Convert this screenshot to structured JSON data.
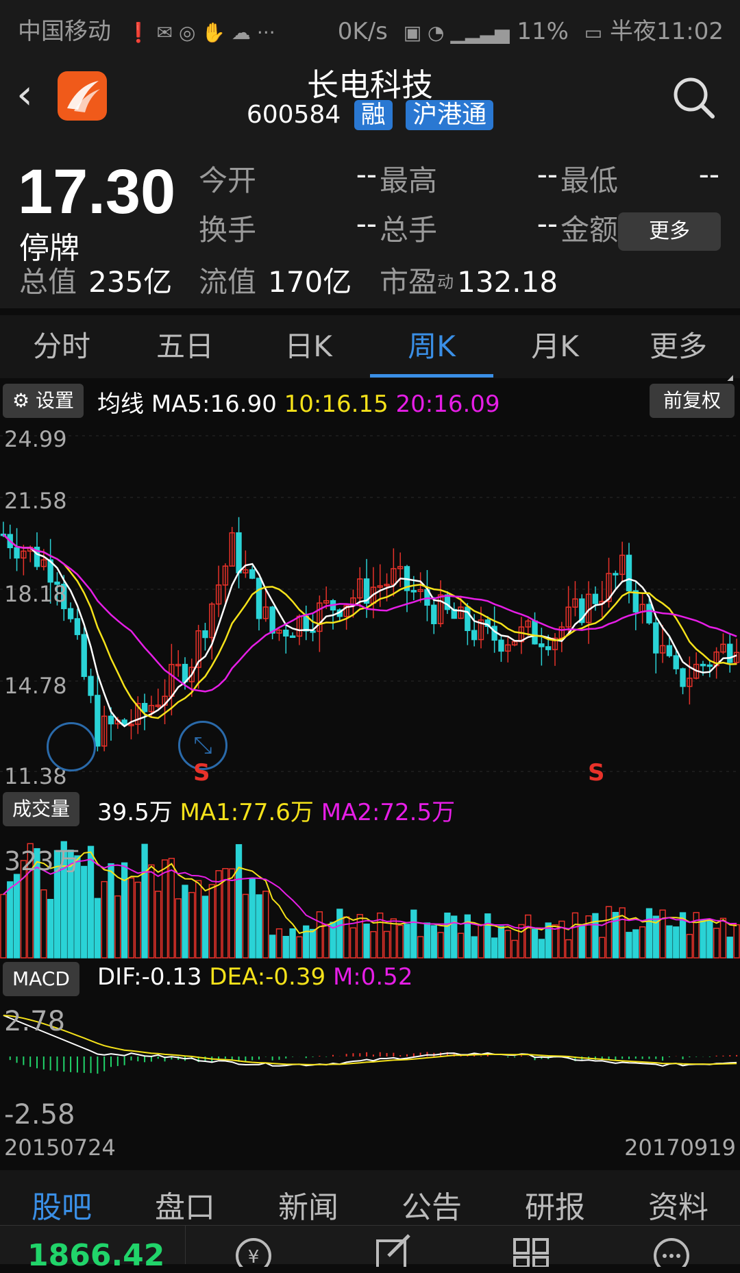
{
  "status_bar": {
    "carrier": "中国移动",
    "speed": "0K/s",
    "battery": "11%",
    "time": "半夜11:02"
  },
  "header": {
    "title": "长电科技",
    "code": "600584",
    "tag1": "融",
    "tag2": "沪港通"
  },
  "quote": {
    "price": "17.30",
    "status": "停牌",
    "open_label": "今开",
    "open": "--",
    "high_label": "最高",
    "high": "--",
    "low_label": "最低",
    "low": "--",
    "turnover_label": "换手",
    "turnover": "--",
    "volume_label": "总手",
    "volume": "--",
    "amount_label": "金额",
    "amount": "--",
    "mktcap_label": "总值",
    "mktcap": "235亿",
    "float_label": "流值",
    "float": "170亿",
    "pe_label": "市盈",
    "pe_sup": "动",
    "pe": "132.18",
    "more": "更多"
  },
  "tabs": [
    "分时",
    "五日",
    "日K",
    "周K",
    "月K",
    "更多"
  ],
  "active_tab": 3,
  "kline": {
    "settings_label": "设置",
    "ma_title": "均线",
    "ma5": "MA5:16.90",
    "ma10": "10:16.15",
    "ma20": "20:16.09",
    "fq_label": "前复权",
    "y_labels": [
      "24.99",
      "21.58",
      "18.18",
      "14.78",
      "11.38"
    ],
    "s_marker": "S"
  },
  "volume": {
    "label": "成交量",
    "current": "39.5万",
    "ma1": "MA1:77.6万",
    "ma2": "MA2:72.5万",
    "y_top": "323万"
  },
  "macd": {
    "label": "MACD",
    "dif": "DIF:-0.13",
    "dea": "DEA:-0.39",
    "m": "M:0.52",
    "y_top": "2.78",
    "y_bottom": "-2.58"
  },
  "dates": {
    "start": "20150724",
    "end": "20170919"
  },
  "bottom_tabs": [
    "股吧",
    "盘口",
    "新闻",
    "公告",
    "研报",
    "资料"
  ],
  "active_bottom_tab": 0,
  "index_value": "1866.42",
  "colors": {
    "up": "#e8322a",
    "down": "#2ad3d6",
    "ma5": "#ffffff",
    "ma10": "#f5e21a",
    "ma20": "#e61ee6",
    "accent": "#3a8fe6",
    "index": "#21d46a"
  }
}
